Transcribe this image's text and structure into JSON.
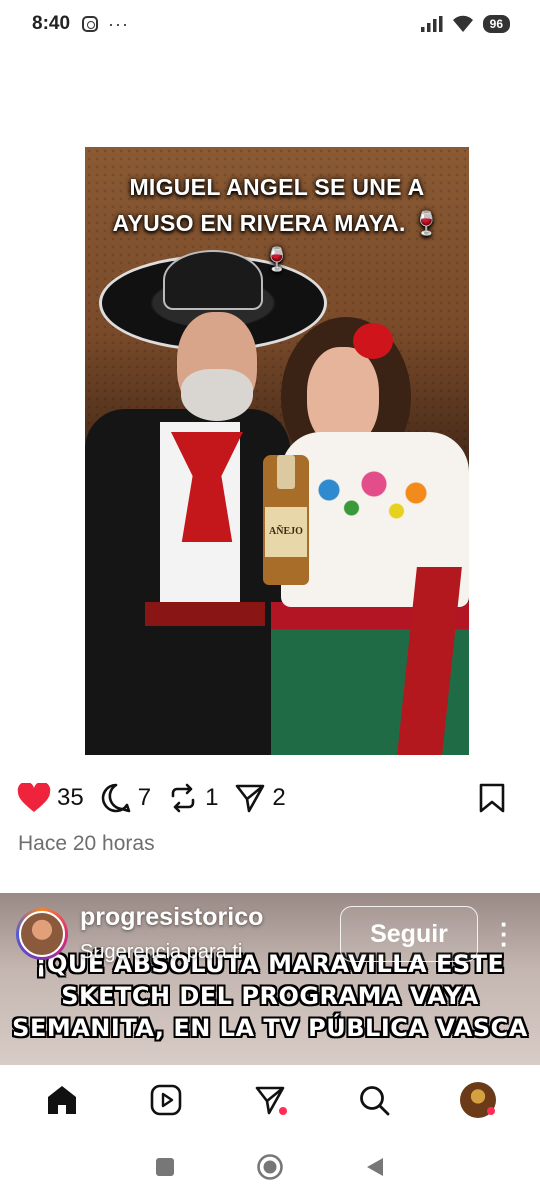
{
  "status_bar": {
    "time": "8:40",
    "dots": "···",
    "battery": "96"
  },
  "post": {
    "image_caption": "MIGUEL ANGEL SE UNE A AYUSO EN RIVERA MAYA. 🍷🍷",
    "bottle_label": "AÑEJO",
    "likes": "35",
    "comments": "7",
    "reposts": "1",
    "shares": "2",
    "timestamp": "Hace 20 horas",
    "like_color": "#ef233c"
  },
  "suggestion": {
    "username": "progresistorico",
    "subtitle": "Sugerencia para ti",
    "follow_label": "Seguir",
    "title_text": "¡QUÉ ABSOLUTA MARAVILLA ESTE SKETCH DEL PROGRAMA VAYA SEMANITA, EN LA TV PÚBLICA VASCA"
  },
  "bottom_nav": {
    "items": [
      "home-icon",
      "reels-icon",
      "send-icon",
      "search-icon",
      "profile-avatar"
    ],
    "notification_color": "#ff2d55"
  },
  "system_nav": {
    "items": [
      "recents",
      "home",
      "back"
    ]
  }
}
